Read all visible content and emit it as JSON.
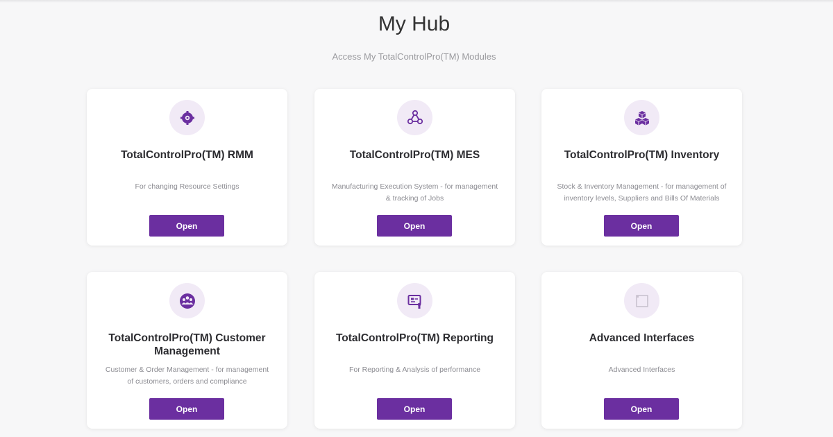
{
  "header": {
    "title": "My Hub",
    "subtitle": "Access My TotalControlPro(TM) Modules"
  },
  "colors": {
    "accent": "#6b2fa0",
    "icon_bg": "#f1eaf6",
    "page_bg": "#f7f7f8"
  },
  "modules": [
    {
      "title": "TotalControlPro(TM) RMM",
      "description": "For changing Resource Settings",
      "button_label": "Open",
      "icon": "gear-icon"
    },
    {
      "title": "TotalControlPro(TM) MES",
      "description": "Manufacturing Execution System - for management & tracking of Jobs",
      "button_label": "Open",
      "icon": "network-nodes-icon"
    },
    {
      "title": "TotalControlPro(TM) Inventory",
      "description": "Stock & Inventory Management - for management of inventory levels, Suppliers and Bills Of Materials",
      "button_label": "Open",
      "icon": "boxes-icon"
    },
    {
      "title": "TotalControlPro(TM) Customer Management",
      "description": "Customer & Order Management - for management of customers, orders and compliance",
      "button_label": "Open",
      "icon": "customers-icon"
    },
    {
      "title": "TotalControlPro(TM) Reporting",
      "description": "For Reporting & Analysis of performance",
      "button_label": "Open",
      "icon": "report-icon"
    },
    {
      "title": "Advanced Interfaces",
      "description": "Advanced Interfaces",
      "button_label": "Open",
      "icon": "square-icon"
    }
  ]
}
